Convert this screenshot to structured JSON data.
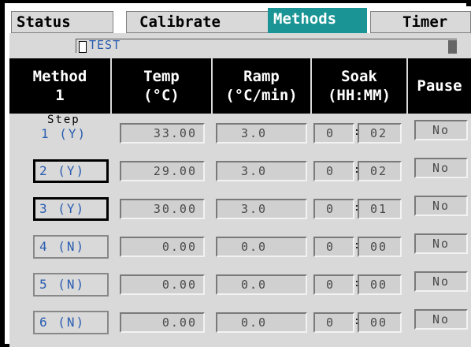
{
  "tabs": {
    "status": "Status",
    "calibrate": "Calibrate",
    "methods": "Methods",
    "timer": "Timer"
  },
  "strip": {
    "label": "TEST"
  },
  "header": {
    "method_line1": "Method",
    "method_line2": "1",
    "temp_line1": "Temp",
    "temp_line2": "(°C)",
    "ramp_line1": "Ramp",
    "ramp_line2": "(°C/min)",
    "soak_line1": "Soak",
    "soak_line2": "(HH:MM)",
    "pause": "Pause"
  },
  "step_heading": "Step",
  "rows": [
    {
      "step": "1 (Y)",
      "temp": "33.00",
      "ramp": "3.0",
      "hh": "0",
      "mm": "02",
      "pause": "No"
    },
    {
      "step": "2 (Y)",
      "temp": "29.00",
      "ramp": "3.0",
      "hh": "0",
      "mm": "02",
      "pause": "No"
    },
    {
      "step": "3 (Y)",
      "temp": "30.00",
      "ramp": "3.0",
      "hh": "0",
      "mm": "01",
      "pause": "No"
    },
    {
      "step": "4 (N)",
      "temp": "0.00",
      "ramp": "0.0",
      "hh": "0",
      "mm": "00",
      "pause": "No"
    },
    {
      "step": "5 (N)",
      "temp": "0.00",
      "ramp": "0.0",
      "hh": "0",
      "mm": "00",
      "pause": "No"
    },
    {
      "step": "6 (N)",
      "temp": "0.00",
      "ramp": "0.0",
      "hh": "0",
      "mm": "00",
      "pause": "No"
    }
  ],
  "colors": {
    "active_tab": "#1a9494",
    "panel": "#d9d9d9",
    "header_bg": "#000000",
    "value_text": "#2a5db0"
  }
}
